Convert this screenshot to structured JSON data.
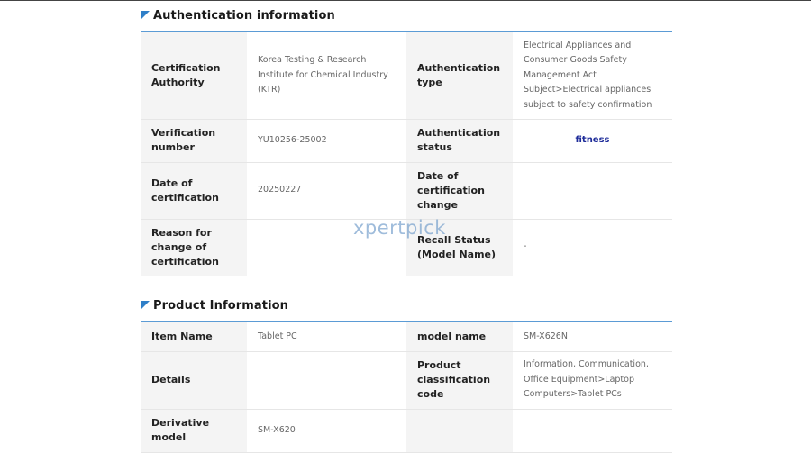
{
  "auth": {
    "title": "Authentication information",
    "rows": [
      {
        "l1": "Certification Authority",
        "v1": "Korea Testing & Research Institute for Chemical Industry (KTR)",
        "l2": "Authentication type",
        "v2": "Electrical Appliances and Consumer Goods Safety Management Act Subject>Electrical appliances subject to safety confirmation"
      },
      {
        "l1": "Verification number",
        "v1": "YU10256-25002",
        "l2": "Authentication status",
        "v2": "fitness"
      },
      {
        "l1": "Date of certification",
        "v1": "20250227",
        "l2": "Date of certification change",
        "v2": ""
      },
      {
        "l1": "Reason for change of certification",
        "v1": "",
        "l2": "Recall Status (Model Name)",
        "v2": "-"
      }
    ]
  },
  "product": {
    "title": "Product Information",
    "rows": [
      {
        "l1": "Item Name",
        "v1": "Tablet PC",
        "l2": "model name",
        "v2": "SM-X626N"
      },
      {
        "l1": "Details",
        "v1": "",
        "l2": "Product classification code",
        "v2": "Information, Communication, Office Equipment>Laptop Computers>Tablet PCs"
      },
      {
        "l1": "Derivative model",
        "v1": "SM-X620",
        "l2": "",
        "v2": ""
      }
    ]
  },
  "watermark": "xpertpick",
  "colors": {
    "accent": "#5b9bd5",
    "status": "#1f2d9a",
    "header_cell": "#f4f4f4"
  }
}
